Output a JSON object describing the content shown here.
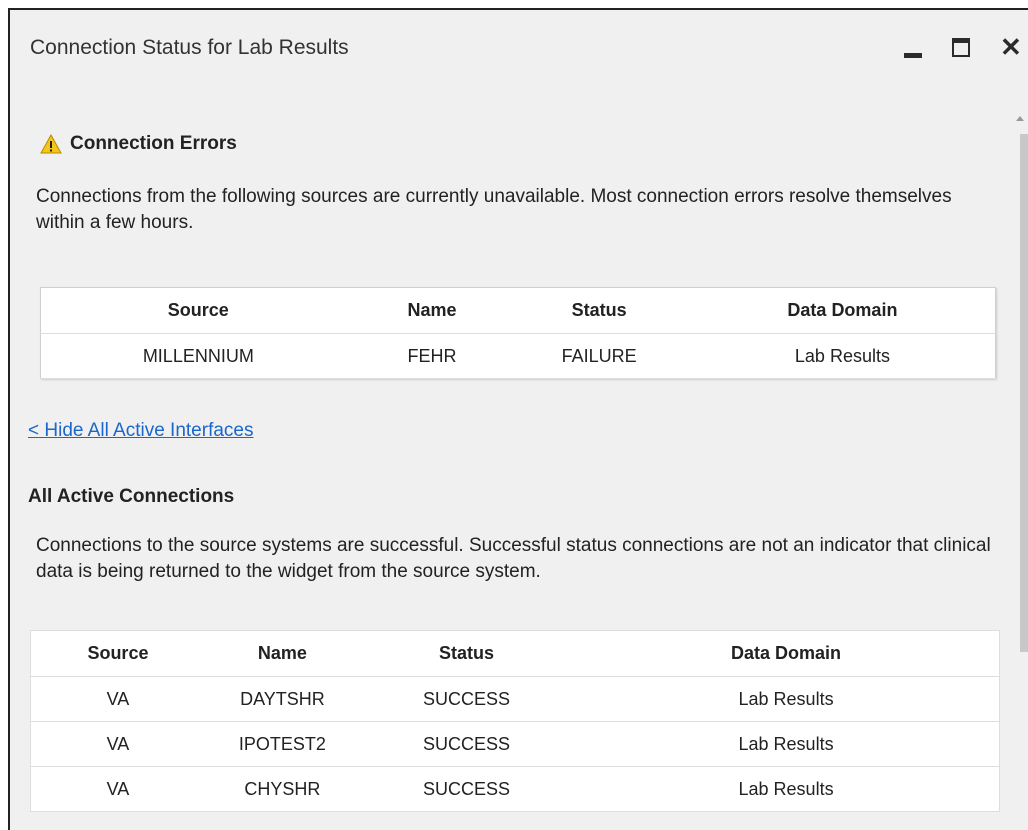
{
  "window": {
    "title": "Connection Status for Lab Results",
    "controls": {
      "minimize_icon": "minimize-icon",
      "maximize_icon": "maximize-icon",
      "close_icon": "close-icon",
      "close_glyph": "✕"
    }
  },
  "errors": {
    "icon": "warning-icon",
    "title": "Connection Errors",
    "description": "Connections from the following sources are currently unavailable. Most connection errors resolve themselves within a few hours.",
    "columns": [
      "Source",
      "Name",
      "Status",
      "Data Domain"
    ],
    "rows": [
      [
        "MILLENNIUM",
        "FEHR",
        "FAILURE",
        "Lab Results"
      ]
    ]
  },
  "toggle_link": "< Hide All Active Interfaces",
  "active": {
    "title": "All Active Connections",
    "description": "Connections to the source systems are successful. Successful status connections are not an indicator that clinical data is being returned to the widget from the source system.",
    "columns": [
      "Source",
      "Name",
      "Status",
      "Data Domain"
    ],
    "rows": [
      [
        "VA",
        "DAYTSHR",
        "SUCCESS",
        "Lab Results"
      ],
      [
        "VA",
        "IPOTEST2",
        "SUCCESS",
        "Lab Results"
      ],
      [
        "VA",
        "CHYSHR",
        "SUCCESS",
        "Lab Results"
      ]
    ]
  },
  "colors": {
    "window_bg": "#f0f0f0",
    "link": "#1a66cc",
    "warning": "#f5c518"
  }
}
